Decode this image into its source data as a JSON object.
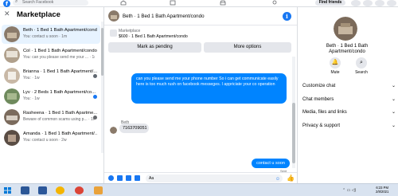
{
  "colors": {
    "brand": "#1877f2",
    "outgoing_bubble": "#0084ff",
    "incoming_bubble": "#e4e6eb",
    "active_row": "#e7f3ff"
  },
  "topbar": {
    "search_placeholder": "Search Facebook",
    "find_friends_label": "Find friends"
  },
  "sidebar": {
    "title": "Marketplace",
    "conversations": [
      {
        "title": "Beth · 1 Bed 1 Bath Apartment/condo",
        "subtitle": "You: contact u soon · 1m",
        "active": true
      },
      {
        "title": "Col · 1 Bed 1 Bath Apartment/condo",
        "subtitle": "You: can you please send me your ... · 1m",
        "active": false
      },
      {
        "title": "Brianna · 1 Bed 1 Bath Apartment/...",
        "subtitle": "You: · 1w",
        "active": false
      },
      {
        "title": "Lyv · 2 Beds 1 Bath Apartment/co...",
        "subtitle": "You: · 1w",
        "active": false
      },
      {
        "title": "Rasheena · 1 Bed 1 Bath Apartme...",
        "subtitle": "Beware of common scams using p... · 1w",
        "active": false
      },
      {
        "title": "Amanda · 1 Bed 1 Bath Apartment/...",
        "subtitle": "You: contact u soon · 2w",
        "active": false
      }
    ]
  },
  "chat": {
    "header_title": "Beth · 1 Bed 1 Bath Apartment/condo",
    "marketplace_label": "Marketplace",
    "listing": "$600 · 1 Bed 1 Bath Apartment/condo",
    "mark_pending_label": "Mark as pending",
    "more_options_label": "More options",
    "outgoing_message": "can you please send me your phone number So i can get communicate easily here is too much rush on facebook messeges. I appriciate your co operation",
    "sender_name": "Beth",
    "incoming_message": "7163709051",
    "outgoing_message_2": "contact u soon",
    "sent_label": "Sent",
    "composer_value": "Aa"
  },
  "right_panel": {
    "name": "Beth · 1 Bed 1 Bath Apartment/condo",
    "mute_label": "Mute",
    "search_label": "Search",
    "rows": [
      "Customize chat",
      "Chat members",
      "Media, files and links",
      "Privacy & support"
    ]
  },
  "taskbar": {
    "time": "6:23 PM",
    "date": "2/8/2021"
  }
}
